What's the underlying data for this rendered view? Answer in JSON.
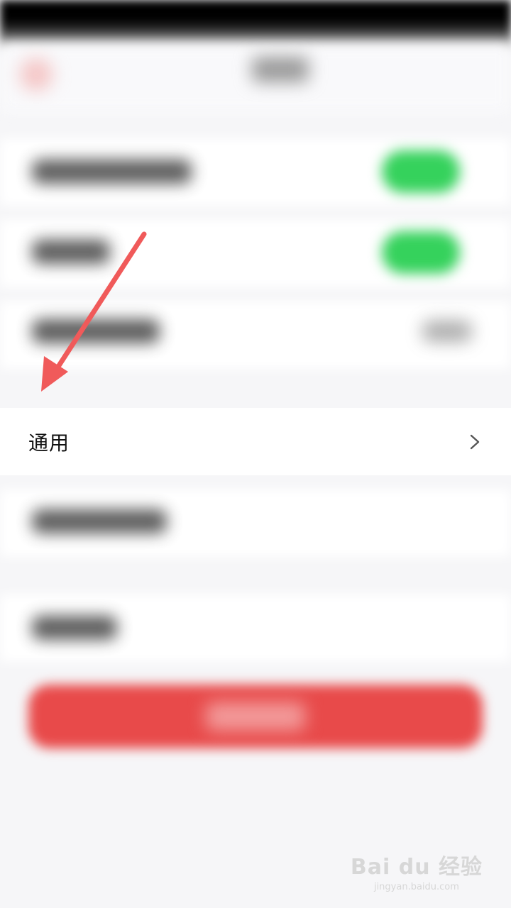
{
  "settings": {
    "general_label": "通用"
  },
  "colors": {
    "toggle_on": "#35d25c",
    "logout_button": "#e84a4a",
    "annotation_arrow": "#f05a5a"
  },
  "icons": {
    "back": "back-arrow-icon",
    "row_chevron": "chevron-right-icon"
  },
  "watermark": {
    "brand": "Bai du 经验",
    "url": "jingyan.baidu.com"
  }
}
